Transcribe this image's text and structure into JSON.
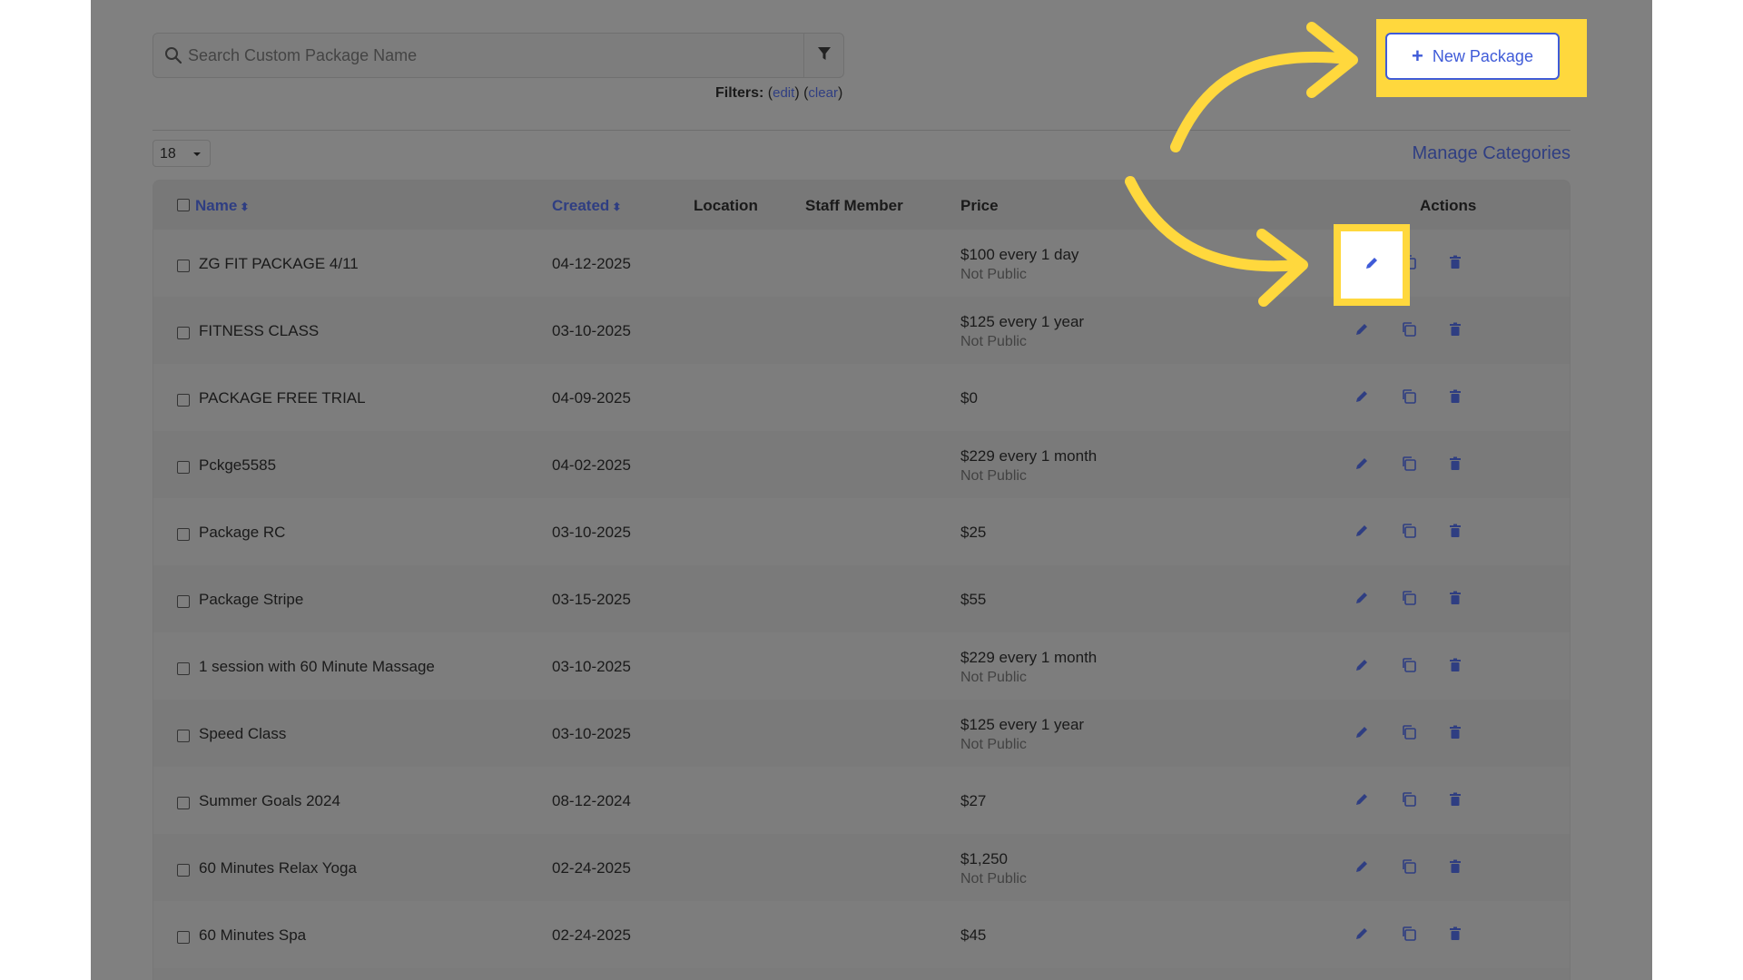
{
  "search": {
    "placeholder": "Search Custom Package Name"
  },
  "filters": {
    "label": "Filters:",
    "edit_link": "edit",
    "clear_link": "clear"
  },
  "pagination": {
    "page_size": "18"
  },
  "manage_categories_label": "Manage Categories",
  "new_package_label": "New Package",
  "table": {
    "columns": {
      "name": "Name",
      "created": "Created",
      "location": "Location",
      "staff_member": "Staff Member",
      "price": "Price",
      "actions": "Actions"
    },
    "rows": [
      {
        "name": "ZG FIT PACKAGE 4/11",
        "created": "04-12-2025",
        "price": "$100 every 1 day",
        "visibility": "Not Public"
      },
      {
        "name": "FITNESS CLASS",
        "created": "03-10-2025",
        "price": "$125 every 1 year",
        "visibility": "Not Public"
      },
      {
        "name": "PACKAGE FREE TRIAL",
        "created": "04-09-2025",
        "price": "$0",
        "visibility": ""
      },
      {
        "name": "Pckge5585",
        "created": "04-02-2025",
        "price": "$229 every 1 month",
        "visibility": "Not Public"
      },
      {
        "name": "Package RC",
        "created": "03-10-2025",
        "price": "$25",
        "visibility": ""
      },
      {
        "name": "Package Stripe",
        "created": "03-15-2025",
        "price": "$55",
        "visibility": ""
      },
      {
        "name": "1 session with 60 Minute Massage",
        "created": "03-10-2025",
        "price": "$229 every 1 month",
        "visibility": "Not Public"
      },
      {
        "name": "Speed Class",
        "created": "03-10-2025",
        "price": "$125 every 1 year",
        "visibility": "Not Public"
      },
      {
        "name": "Summer Goals 2024",
        "created": "08-12-2024",
        "price": "$27",
        "visibility": ""
      },
      {
        "name": "60 Minutes Relax Yoga",
        "created": "02-24-2025",
        "price": "$1,250",
        "visibility": "Not Public"
      },
      {
        "name": "60 Minutes Spa",
        "created": "02-24-2025",
        "price": "$45",
        "visibility": ""
      }
    ]
  },
  "icons": {
    "search": "search-icon",
    "filter": "funnel-icon",
    "edit": "pencil-icon",
    "copy": "copy-icon",
    "delete": "trash-icon",
    "add": "plus-icon",
    "sort": "sort-icon"
  },
  "colors": {
    "overlay": "#808080",
    "link": "#2f3e82",
    "accent": "#3f5bd8",
    "highlight": "#ffd83d"
  }
}
